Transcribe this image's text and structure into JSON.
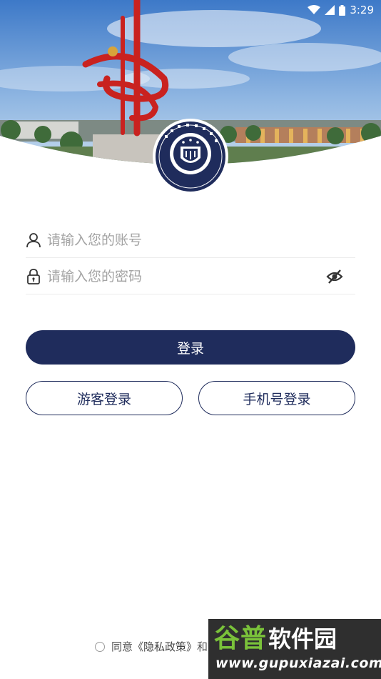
{
  "status_bar": {
    "time": "3:29"
  },
  "emblem": {
    "year": "1958"
  },
  "login_form": {
    "account_placeholder": "请输入您的账号",
    "password_placeholder": "请输入您的密码"
  },
  "buttons": {
    "login": "登录",
    "guest_login": "游客登录",
    "phone_login": "手机号登录"
  },
  "agreement": {
    "prefix": "同意",
    "privacy_policy": "《隐私政策》",
    "connector": "和"
  },
  "watermark": {
    "site_name_part1": "谷普",
    "site_name_part2": "软件园",
    "url": "www.gupuxiazai.com"
  },
  "colors": {
    "primary": "#1f2c5c",
    "placeholder": "#a3a3a3",
    "divider": "#ececec"
  },
  "icons": [
    "user-icon",
    "lock-icon",
    "eye-off-icon",
    "wifi-icon",
    "signal-icon",
    "battery-icon"
  ]
}
